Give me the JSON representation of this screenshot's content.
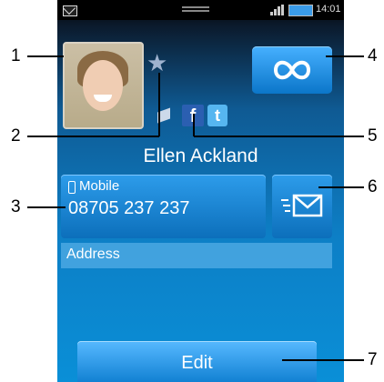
{
  "statusbar": {
    "time": "14:01",
    "icons": [
      "mail-icon",
      "drag-handle-icon",
      "signal-icon",
      "battery-icon"
    ]
  },
  "contact": {
    "name": "Ellen Ackland",
    "photo": "contact-photo",
    "favorite_icon": "star-icon"
  },
  "top_action": {
    "icon": "infinite-icon"
  },
  "social": {
    "items": [
      {
        "name": "generic-status-icon"
      },
      {
        "name": "facebook-icon",
        "glyph": "f"
      },
      {
        "name": "twitter-icon",
        "glyph": "t"
      }
    ]
  },
  "phone": {
    "type_label": "Mobile",
    "number": "08705 237 237"
  },
  "message_button": {
    "icon": "message-icon"
  },
  "address": {
    "label": "Address"
  },
  "edit": {
    "label": "Edit"
  },
  "callouts": {
    "c1": "1",
    "c2": "2",
    "c3": "3",
    "c4": "4",
    "c5": "5",
    "c6": "6",
    "c7": "7"
  },
  "colors": {
    "accent": "#0d7fc6",
    "button": "#2d9cea",
    "facebook": "#2b5fb1",
    "twitter": "#56b6f0"
  }
}
